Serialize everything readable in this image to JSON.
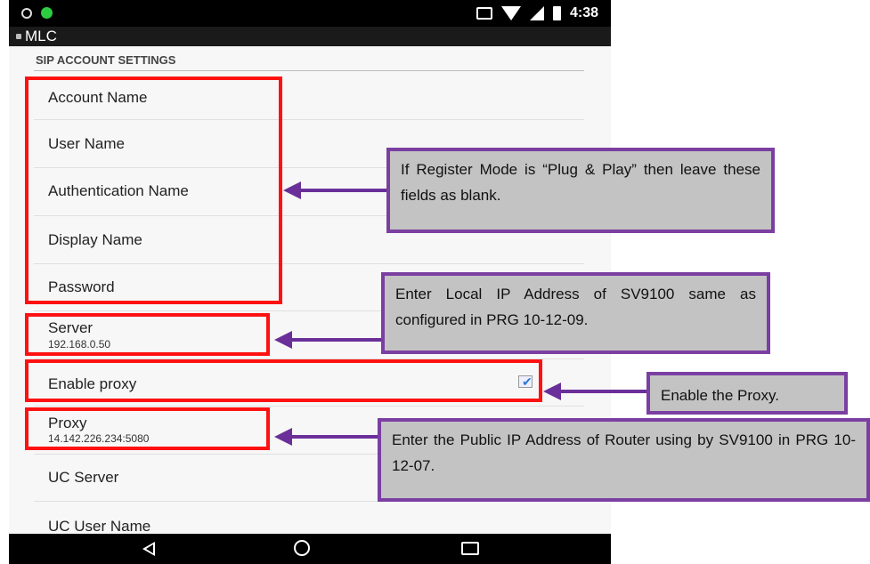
{
  "app": {
    "title": "MLC"
  },
  "status_bar": {
    "time": "4:38",
    "icons": [
      "vibrate-icon",
      "wifi-icon",
      "signal-icon",
      "battery-icon"
    ]
  },
  "section": {
    "header": "SIP ACCOUNT SETTINGS"
  },
  "settings": {
    "account_name": "Account Name",
    "user_name": "User Name",
    "authentication_name": "Authentication Name",
    "display_name": "Display Name",
    "password": "Password",
    "server_label": "Server",
    "server_value": "192.168.0.50",
    "enable_proxy_label": "Enable proxy",
    "enable_proxy_checked": true,
    "proxy_label": "Proxy",
    "proxy_value": "14.142.226.234:5080",
    "uc_server": "UC Server",
    "uc_user_name": "UC User Name"
  },
  "annotations": {
    "plug_play": "If Register Mode is “Plug & Play” then leave these fields as blank.",
    "server": "Enter Local IP Address of SV9100 same as configured in PRG 10-12-09.",
    "proxy_enable": "Enable the Proxy.",
    "proxy": "Enter the Public IP Address of Router using by SV9100 in PRG 10-12-07."
  },
  "colors": {
    "highlight": "#ff1111",
    "callout_border": "#7b3fa2",
    "callout_fill": "#c3c3c3",
    "arrow": "#6a2f99",
    "checkbox": "#2a7ad8"
  }
}
